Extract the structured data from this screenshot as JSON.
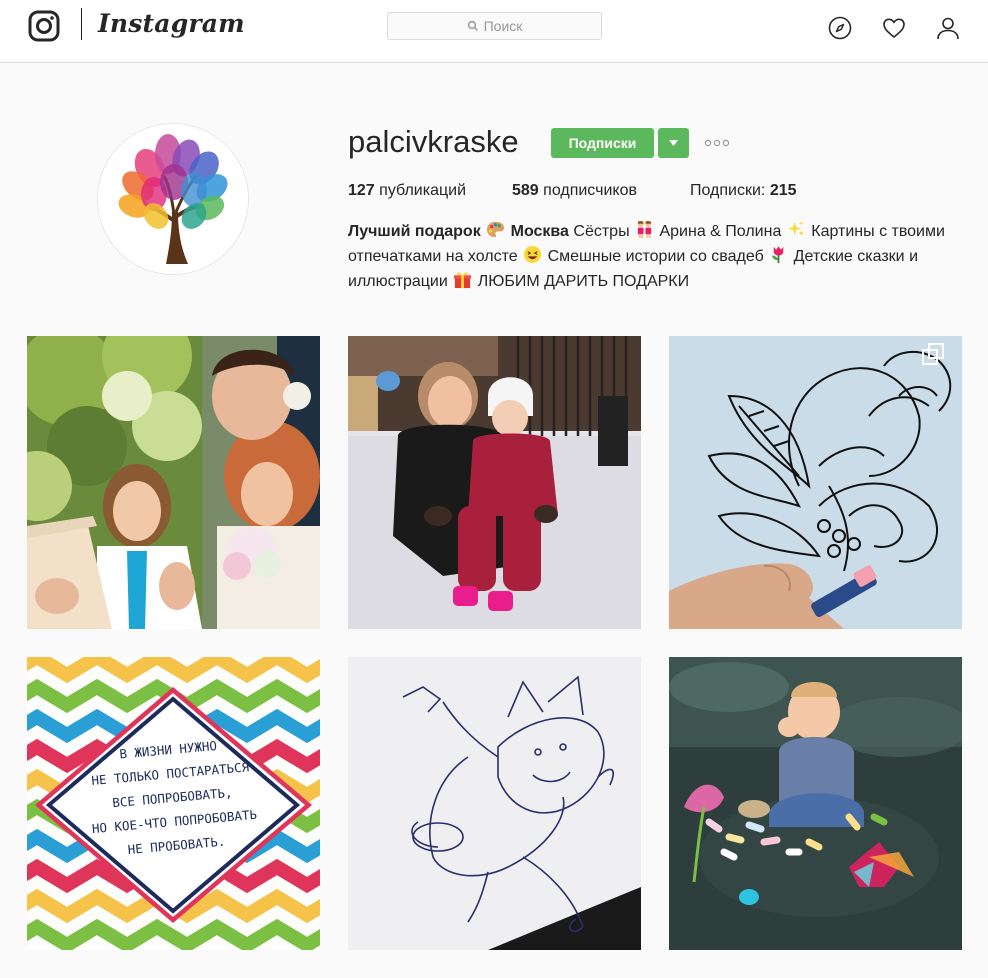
{
  "header": {
    "wordmark": "Instagram",
    "search_placeholder": "Поиск",
    "icons": [
      "instagram-camera-icon",
      "search-icon",
      "compass-icon",
      "heart-icon",
      "person-icon"
    ]
  },
  "profile": {
    "username": "palcivkraske",
    "follow_label": "Подписки",
    "stats": {
      "posts_count": "127",
      "posts_label": "публикаций",
      "followers_count": "589",
      "followers_label": "подписчиков",
      "following_label": "Подписки:",
      "following_count": "215"
    },
    "bio": {
      "name": "Лучший подарок",
      "city": "Москва",
      "text1": "Сёстры",
      "text2": "Арина & Полина",
      "text3": "Картины с твоими отпечатками на холсте",
      "text4": "Смешные истории со свадеб",
      "text5": "Детские сказки и иллюстрации",
      "text6": "ЛЮБИМ ДАРИТЬ ПОДАРКИ"
    }
  },
  "posts": [
    {
      "alt": "wedding-photo"
    },
    {
      "alt": "mother-child-snow"
    },
    {
      "alt": "ink-drawing"
    },
    {
      "alt": "quote-card",
      "quote_lines": [
        "В ЖИЗНИ НУЖНО",
        "НЕ ТОЛЬКО ПОСТАРАТЬСЯ",
        "ВСЕ ПОПРОБОВАТЬ,",
        "НО КОЕ-ЧТО ПОПРОБОВАТЬ",
        "НЕ ПРОБОВАТЬ."
      ]
    },
    {
      "alt": "child-sketch"
    },
    {
      "alt": "toddler-chalk"
    }
  ],
  "colors": {
    "follow_green": "#5cb85c",
    "border": "#dbdbdb",
    "background": "#fafafa",
    "quote_navy": "#1d2b5c"
  }
}
